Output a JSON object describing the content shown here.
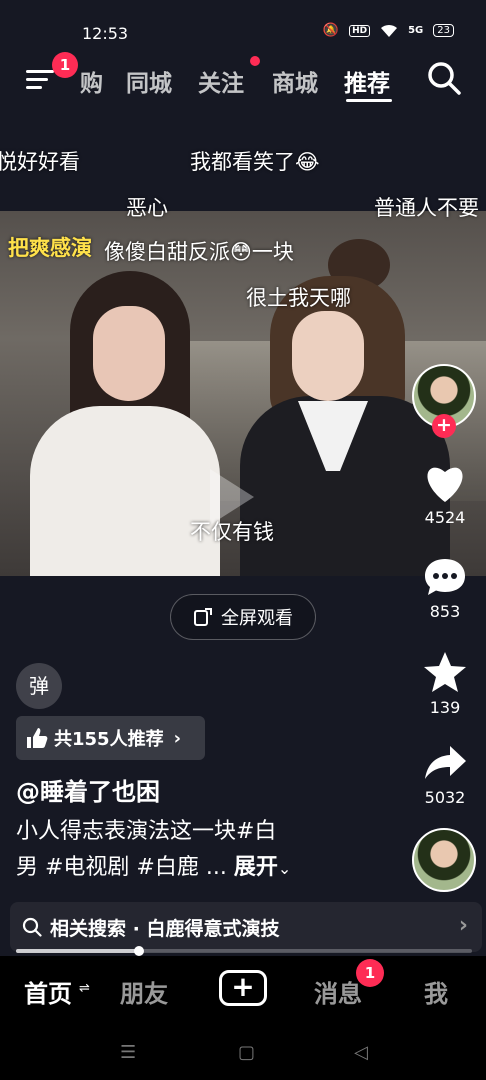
{
  "status_bar": {
    "time": "12:53",
    "hd": "HD",
    "signal": "5G",
    "battery": "23"
  },
  "top_nav": {
    "badge": "1",
    "tabs": [
      {
        "label": "购"
      },
      {
        "label": "同城"
      },
      {
        "label": "关注"
      },
      {
        "label": "商城"
      },
      {
        "label": "推荐",
        "active": true
      }
    ]
  },
  "danmaku": [
    "悦好好看",
    "我都看笑了😂",
    "恶心",
    "普通人不要",
    "把爽感演",
    "像傻白甜反派😳一块",
    "很土我天哪",
    "不仅有钱"
  ],
  "fullscreen_label": "全屏观看",
  "side_actions": {
    "likes": "4524",
    "comments": "853",
    "favorites": "139",
    "shares": "5032"
  },
  "danmaku_toggle": "弹",
  "recommend": "共155人推荐",
  "author": "@睡着了也困",
  "description": {
    "line1": "小人得志表演法这一块#白",
    "line2": "男 #电视剧 #白鹿 ...",
    "more": "展开"
  },
  "related_search": "相关搜索 · 白鹿得意式演技",
  "progress": 0.27,
  "bottom_nav": {
    "home": "首页",
    "friends": "朋友",
    "plus": "+",
    "messages": "消息",
    "messages_badge": "1",
    "me": "我"
  },
  "colors": {
    "accent": "#fe2c55",
    "danmaku_highlight": "#ffe14a",
    "background": "#161823"
  }
}
